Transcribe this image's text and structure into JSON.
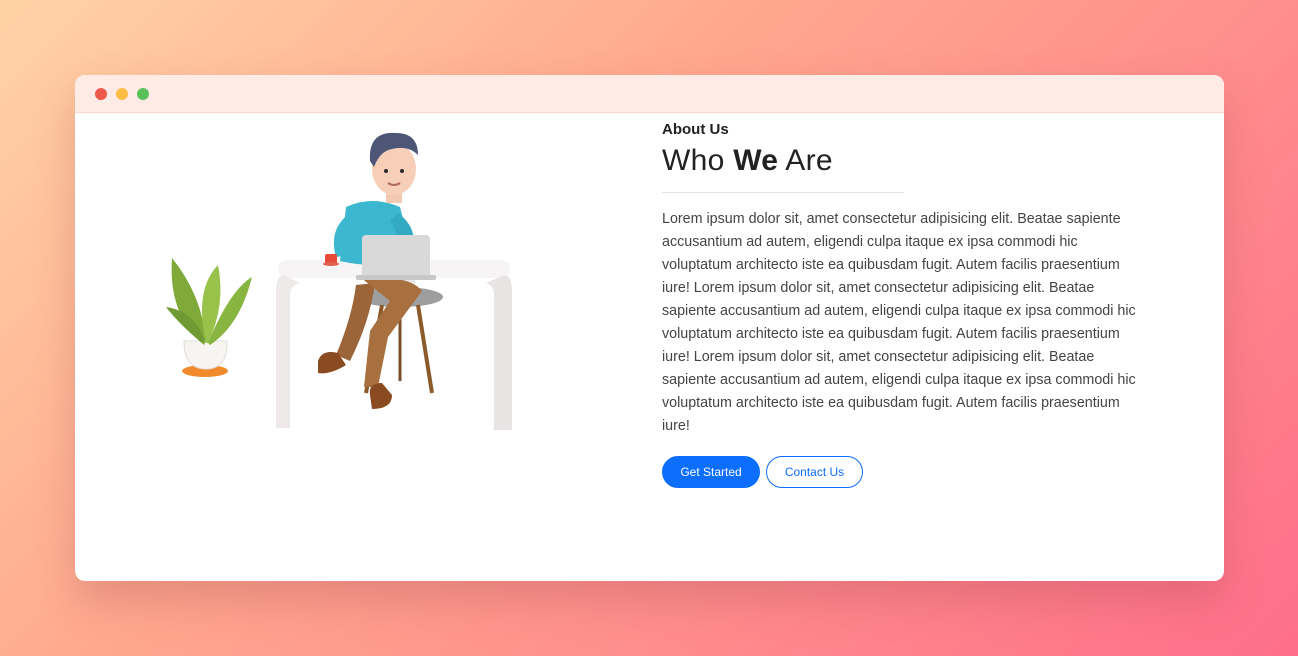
{
  "window": {
    "controls": [
      "close",
      "minimize",
      "maximize"
    ],
    "colors": {
      "close": "#ed594a",
      "minimize": "#fdbd41",
      "maximize": "#5ac05a"
    }
  },
  "illustration": {
    "icon": "person-at-desk-illustration"
  },
  "about": {
    "eyebrow": "About Us",
    "heading_part1": "Who ",
    "heading_strong": "We",
    "heading_part2": " Are",
    "body": "Lorem ipsum dolor sit, amet consectetur adipisicing elit. Beatae sapiente accusantium ad autem, eligendi culpa itaque ex ipsa commodi hic voluptatum architecto iste ea quibusdam fugit. Autem facilis praesentium iure! Lorem ipsum dolor sit, amet consectetur adipisicing elit. Beatae sapiente accusantium ad autem, eligendi culpa itaque ex ipsa commodi hic voluptatum architecto iste ea quibusdam fugit. Autem facilis praesentium iure! Lorem ipsum dolor sit, amet consectetur adipisicing elit. Beatae sapiente accusantium ad autem, eligendi culpa itaque ex ipsa commodi hic voluptatum architecto iste ea quibusdam fugit. Autem facilis praesentium iure!"
  },
  "actions": {
    "primary_label": "Get Started",
    "secondary_label": "Contact Us"
  },
  "colors": {
    "accent": "#0d6efd",
    "titlebar": "#ffebe6",
    "text": "#444444"
  }
}
